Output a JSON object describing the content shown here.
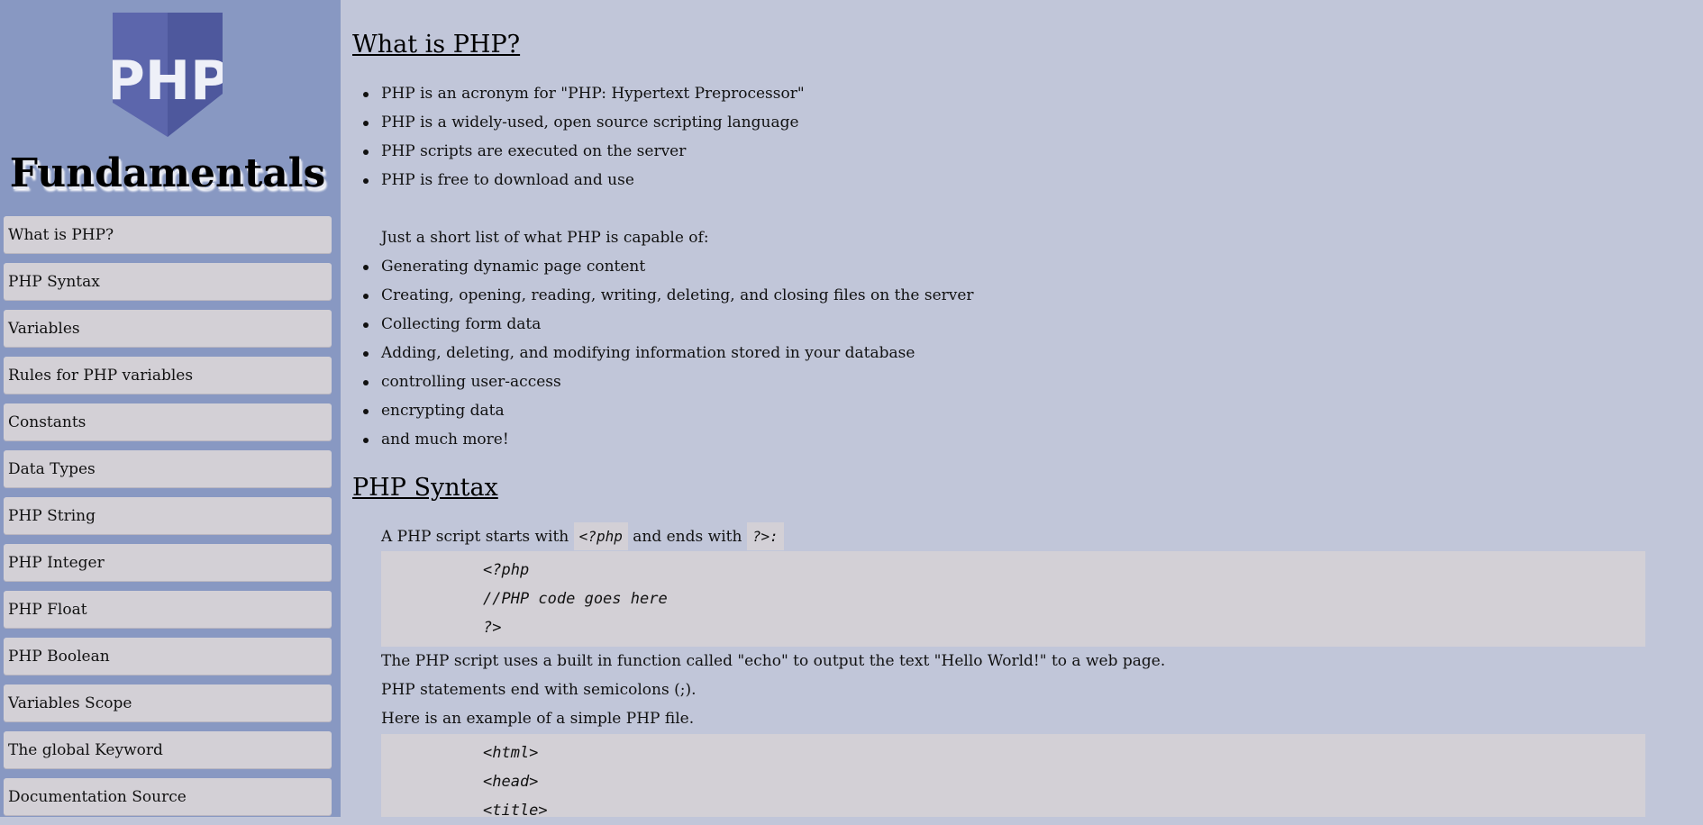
{
  "sidebar": {
    "logo_text": "PHP",
    "title": "Fundamentals",
    "nav": [
      "What is PHP?",
      "PHP Syntax",
      "Variables",
      "Rules for PHP variables",
      "Constants",
      "Data Types",
      "PHP String",
      "PHP Integer",
      "PHP Float",
      "PHP Boolean",
      "Variables Scope",
      "The global Keyword",
      "Documentation Source"
    ]
  },
  "sections": {
    "what": {
      "title": "What is PHP?",
      "bullets": [
        "PHP is an acronym for \"PHP: Hypertext Preprocessor\"",
        "PHP is a widely-used, open source scripting language",
        "PHP scripts are executed on the server",
        "PHP is free to download and use"
      ],
      "capable_intro": "Just a short list of what PHP is capable of:",
      "capable_bullets": [
        "Generating dynamic page content",
        "Creating, opening, reading, writing, deleting, and closing files on the server",
        "Collecting form data",
        "Adding, deleting, and modifying information stored in your database",
        "controlling user-access",
        "encrypting data",
        "and much more!"
      ]
    },
    "syntax": {
      "title": "PHP Syntax",
      "starts_prefix": "A PHP script starts with",
      "starts_code": "<?php",
      "ends_text": "and ends with",
      "ends_code": "?>:",
      "code1": [
        "<?php",
        "//PHP code goes here",
        "?>"
      ],
      "para1": "The PHP script uses a built in function called \"echo\" to output the text \"Hello World!\" to a web page.",
      "para2": "PHP statements end with semicolons (;).",
      "para3": "Here is an example of a simple PHP file.",
      "code2": [
        "<html>",
        "<head>",
        "<title>"
      ]
    }
  },
  "colors": {
    "page_bg": "#c1c6d9",
    "sidebar_bg": "#8898c2",
    "nav_item_bg": "#d3d0d6",
    "code_bg": "#d3d0d6",
    "logo_bg": "#5c66ac"
  }
}
